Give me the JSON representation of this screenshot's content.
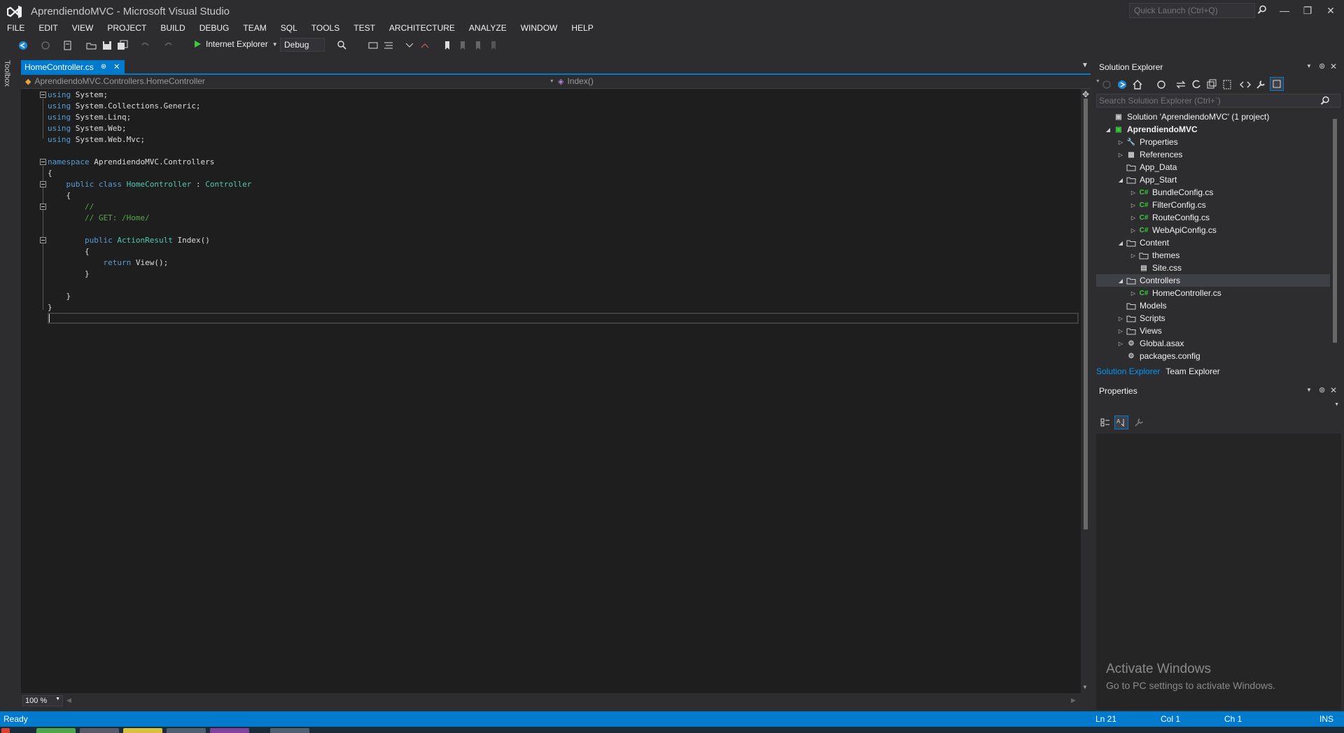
{
  "window": {
    "title": "AprendiendoMVC - Microsoft Visual Studio",
    "quick_launch_placeholder": "Quick Launch (Ctrl+Q)"
  },
  "menu": [
    "FILE",
    "EDIT",
    "VIEW",
    "PROJECT",
    "BUILD",
    "DEBUG",
    "TEAM",
    "SQL",
    "TOOLS",
    "TEST",
    "ARCHITECTURE",
    "ANALYZE",
    "WINDOW",
    "HELP"
  ],
  "toolbar": {
    "run_target": "Internet Explorer",
    "configuration": "Debug"
  },
  "toolbox_label": "Toolbox",
  "editor": {
    "tab_label": "HomeController.cs",
    "nav_class": "AprendiendoMVC.Controllers.HomeController",
    "nav_member": "Index()",
    "zoom": "100 %",
    "code_lines": [
      "using System;",
      "using System.Collections.Generic;",
      "using System.Linq;",
      "using System.Web;",
      "using System.Web.Mvc;",
      "",
      "namespace AprendiendoMVC.Controllers",
      "{",
      "    public class HomeController : Controller",
      "    {",
      "        //",
      "        // GET: /Home/",
      "",
      "        public ActionResult Index()",
      "        {",
      "            return View();",
      "        }",
      "",
      "    }",
      "}",
      ""
    ]
  },
  "solution_explorer": {
    "title": "Solution Explorer",
    "search_placeholder": "Search Solution Explorer (Ctrl+`)",
    "items": [
      {
        "label": "Solution 'AprendiendoMVC' (1 project)",
        "level": 0,
        "arrow": "",
        "icon": "solution-icon"
      },
      {
        "label": "AprendiendoMVC",
        "level": 0,
        "arrow": "expanded",
        "icon": "web-project-icon"
      },
      {
        "label": "Properties",
        "level": 1,
        "arrow": "collapsed",
        "icon": "wrench-icon"
      },
      {
        "label": "References",
        "level": 1,
        "arrow": "collapsed",
        "icon": "references-icon"
      },
      {
        "label": "App_Data",
        "level": 1,
        "arrow": "",
        "icon": "folder-icon"
      },
      {
        "label": "App_Start",
        "level": 1,
        "arrow": "expanded",
        "icon": "folder-icon"
      },
      {
        "label": "BundleConfig.cs",
        "level": 2,
        "arrow": "collapsed",
        "icon": "csharp-file-icon"
      },
      {
        "label": "FilterConfig.cs",
        "level": 2,
        "arrow": "collapsed",
        "icon": "csharp-file-icon"
      },
      {
        "label": "RouteConfig.cs",
        "level": 2,
        "arrow": "collapsed",
        "icon": "csharp-file-icon"
      },
      {
        "label": "WebApiConfig.cs",
        "level": 2,
        "arrow": "collapsed",
        "icon": "csharp-file-icon"
      },
      {
        "label": "Content",
        "level": 1,
        "arrow": "expanded",
        "icon": "folder-icon"
      },
      {
        "label": "themes",
        "level": 2,
        "arrow": "collapsed",
        "icon": "folder-icon"
      },
      {
        "label": "Site.css",
        "level": 2,
        "arrow": "",
        "icon": "css-file-icon"
      },
      {
        "label": "Controllers",
        "level": 1,
        "arrow": "expanded",
        "icon": "folder-icon",
        "selected": true
      },
      {
        "label": "HomeController.cs",
        "level": 2,
        "arrow": "collapsed",
        "icon": "csharp-file-icon"
      },
      {
        "label": "Models",
        "level": 1,
        "arrow": "",
        "icon": "folder-icon"
      },
      {
        "label": "Scripts",
        "level": 1,
        "arrow": "collapsed",
        "icon": "folder-icon"
      },
      {
        "label": "Views",
        "level": 1,
        "arrow": "collapsed",
        "icon": "folder-icon"
      },
      {
        "label": "Global.asax",
        "level": 1,
        "arrow": "collapsed",
        "icon": "global-asax-icon"
      },
      {
        "label": "packages.config",
        "level": 1,
        "arrow": "",
        "icon": "config-file-icon"
      }
    ],
    "tabs": [
      "Solution Explorer",
      "Team Explorer"
    ]
  },
  "properties": {
    "title": "Properties"
  },
  "watermark": {
    "title": "Activate Windows",
    "subtitle": "Go to PC settings to activate Windows."
  },
  "status_bar": {
    "state": "Ready",
    "line": "Ln 21",
    "col": "Col 1",
    "ch": "Ch 1",
    "mode": "INS"
  },
  "colors": {
    "accent": "#007acc",
    "keyword": "#569cd6",
    "type": "#4ec9b0",
    "comment": "#57a64a",
    "editor_bg": "#1e1e1e",
    "chrome_bg": "#2d2d30"
  }
}
